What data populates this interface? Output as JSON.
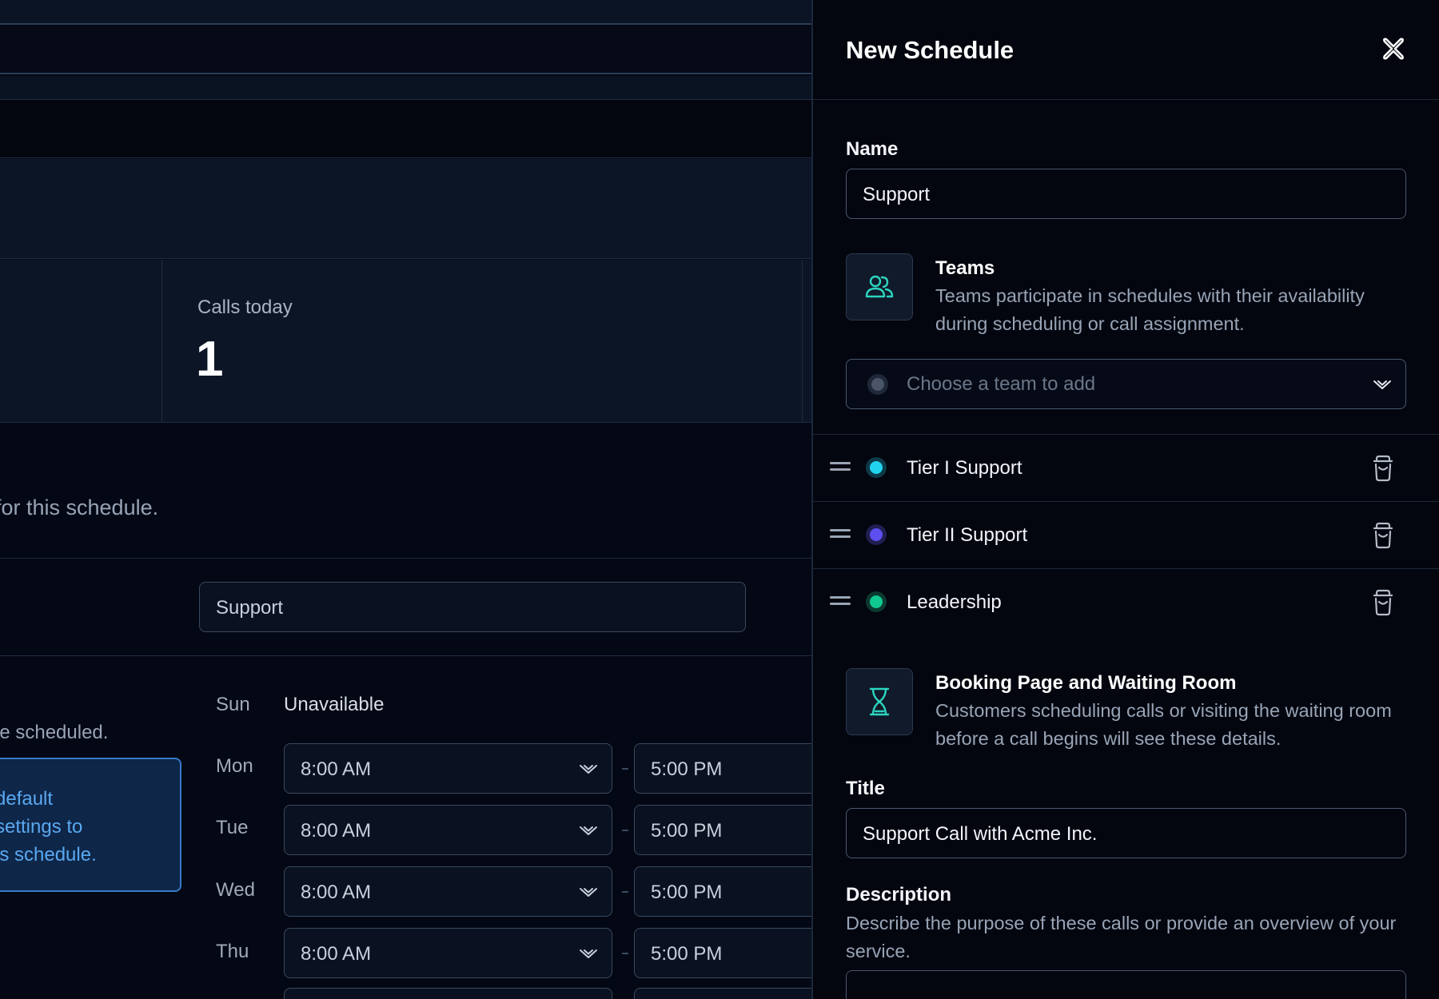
{
  "background": {
    "stat": {
      "label": "Calls today",
      "value": "1"
    },
    "info_text": "for this schedule.",
    "name_field_value": "Support",
    "schedule_hint": "be scheduled.",
    "callout_text": "default\nsettings to\nis schedule.",
    "days": [
      {
        "day": "Sun",
        "value": "Unavailable"
      },
      {
        "day": "Mon",
        "start": "8:00 AM",
        "end": "5:00 PM"
      },
      {
        "day": "Tue",
        "start": "8:00 AM",
        "end": "5:00 PM"
      },
      {
        "day": "Wed",
        "start": "8:00 AM",
        "end": "5:00 PM"
      },
      {
        "day": "Thu",
        "start": "8:00 AM",
        "end": "5:00 PM"
      }
    ]
  },
  "panel": {
    "title": "New Schedule",
    "close_icon": "close-icon",
    "name": {
      "label": "Name",
      "value": "Support"
    },
    "teams": {
      "icon": "users-icon",
      "title": "Teams",
      "description": "Teams participate in schedules with their availability during scheduling or call assignment.",
      "select_placeholder": "Choose a team to add",
      "items": [
        {
          "name": "Tier I Support",
          "color": "#22d3ee"
        },
        {
          "name": "Tier II Support",
          "color": "#5b4ff0"
        },
        {
          "name": "Leadership",
          "color": "#10c98f"
        }
      ]
    },
    "booking": {
      "icon": "hourglass-icon",
      "title": "Booking Page and Waiting Room",
      "description": "Customers scheduling calls or visiting the waiting room before a call begins will see these details."
    },
    "title_field": {
      "label": "Title",
      "value": "Support Call with Acme Inc."
    },
    "description_field": {
      "label": "Description",
      "help": "Describe the purpose of these calls or provide an overview of your service."
    }
  },
  "colors": {
    "accent": "#2dd4bf",
    "panel_bg": "#03060f",
    "page_bg": "#0c1526"
  }
}
